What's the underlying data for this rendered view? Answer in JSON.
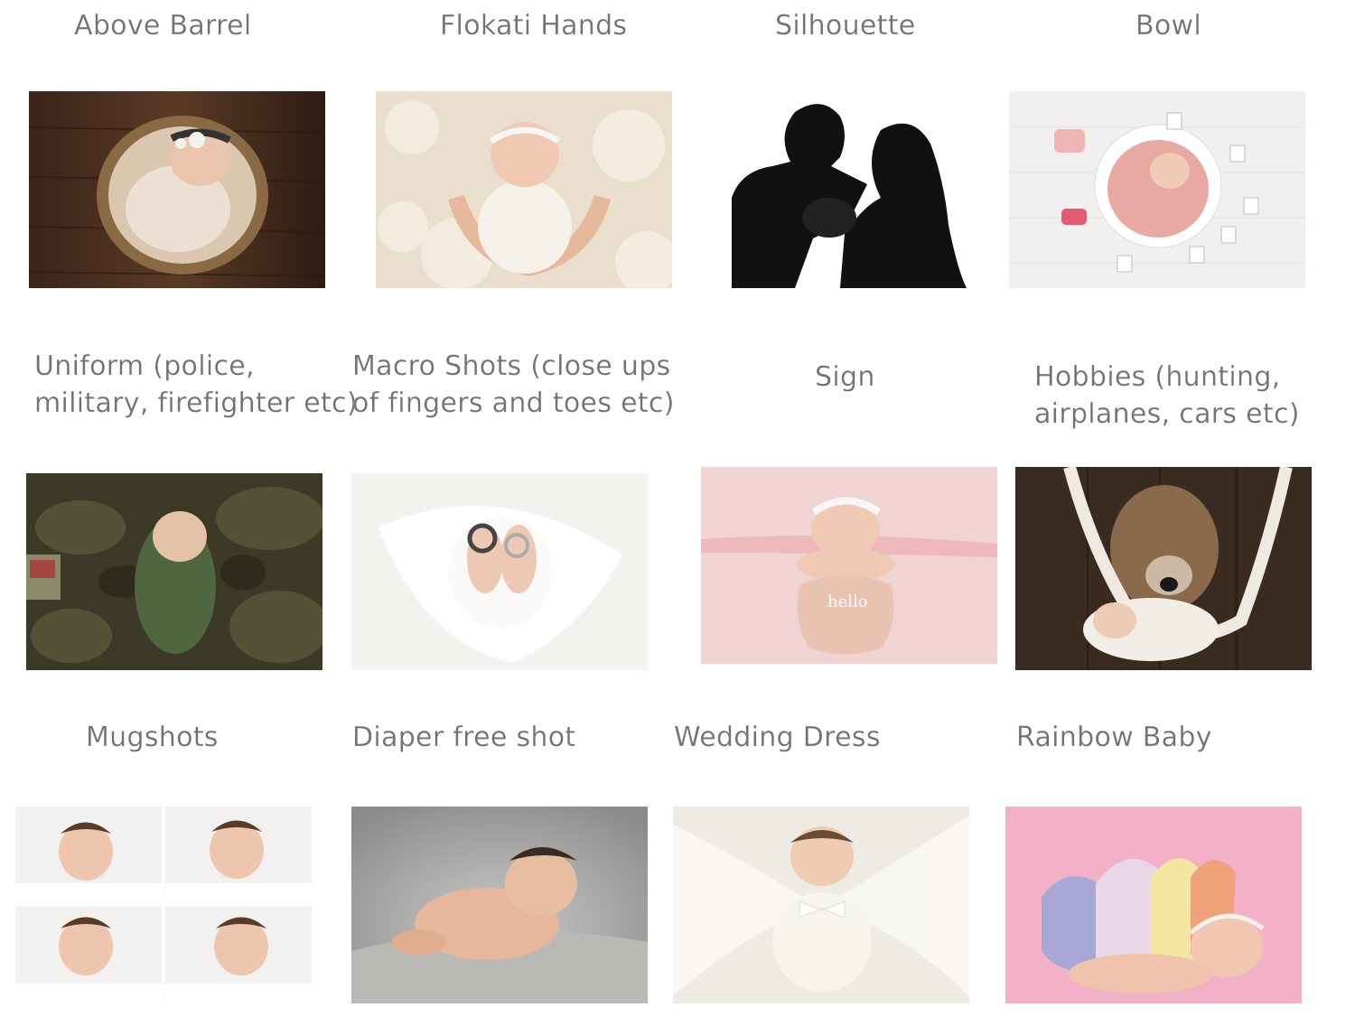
{
  "gallery": {
    "items": [
      {
        "title": "Above Barrel",
        "image": "baby-in-wooden-barrel-photo"
      },
      {
        "title": "Flokati Hands",
        "image": "baby-on-flokati-rug-with-hands-photo"
      },
      {
        "title": "Silhouette",
        "image": "parents-silhouette-photo"
      },
      {
        "title": "Bowl",
        "image": "baby-in-pink-bowl-with-polaroids-photo"
      },
      {
        "title": "Uniform (police,\nmilitary, firefighter etc)",
        "image": "baby-on-military-uniform-photo"
      },
      {
        "title": "Macro Shots (close ups\nof fingers and toes etc)",
        "image": "baby-feet-with-rings-photo"
      },
      {
        "title": "Sign",
        "image": "baby-with-hello-sign-photo"
      },
      {
        "title": "Hobbies (hunting,\nairplanes, cars etc)",
        "image": "baby-in-hammock-with-deer-photo"
      },
      {
        "title": "Mugshots",
        "image": "baby-expressions-collage-photo"
      },
      {
        "title": "Diaper free shot",
        "image": "baby-on-grey-blanket-photo"
      },
      {
        "title": "Wedding Dress",
        "image": "baby-on-wedding-dress-photo"
      },
      {
        "title": "Rainbow Baby",
        "image": "baby-with-rainbow-blanket-photo"
      }
    ]
  },
  "colors": {
    "caption_text": "#727272",
    "background": "#ffffff"
  }
}
